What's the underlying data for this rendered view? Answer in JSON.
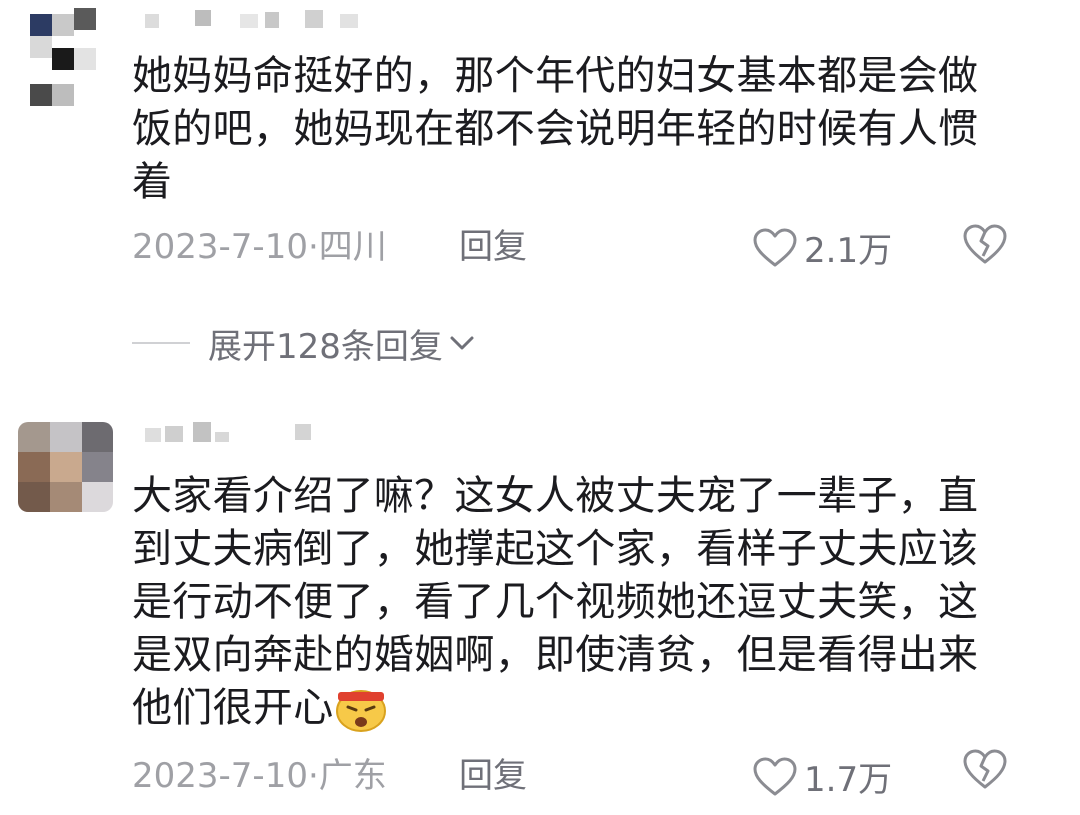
{
  "comments": [
    {
      "text": "她妈妈命挺好的，那个年代的妇女基本都是会做饭的吧，她妈现在都不会说明年轻的时候有人惯着",
      "date_location": "2023-7-10·四川",
      "reply_label": "回复",
      "likes": "2.1万"
    },
    {
      "text": "大家看介绍了嘛？这女人被丈夫宠了一辈子，直到丈夫病倒了，她撑起这个家，看样子丈夫应该是行动不便了，看了几个视频她还逗丈夫笑，这是双向奔赴的婚姻啊，即使清贫，但是看得出来他们很开心",
      "emoji": "angry-headband-emoji",
      "date_location": "2023-7-10·广东",
      "reply_label": "回复",
      "likes": "1.7万"
    }
  ],
  "expand_replies": "展开128条回复",
  "icons": {
    "like": "heart-outline-icon",
    "dislike": "broken-heart-icon",
    "expand": "chevron-down-icon"
  },
  "colors": {
    "text": "#1b1b1f",
    "meta": "#9fa0a5",
    "action": "#6f7078"
  }
}
